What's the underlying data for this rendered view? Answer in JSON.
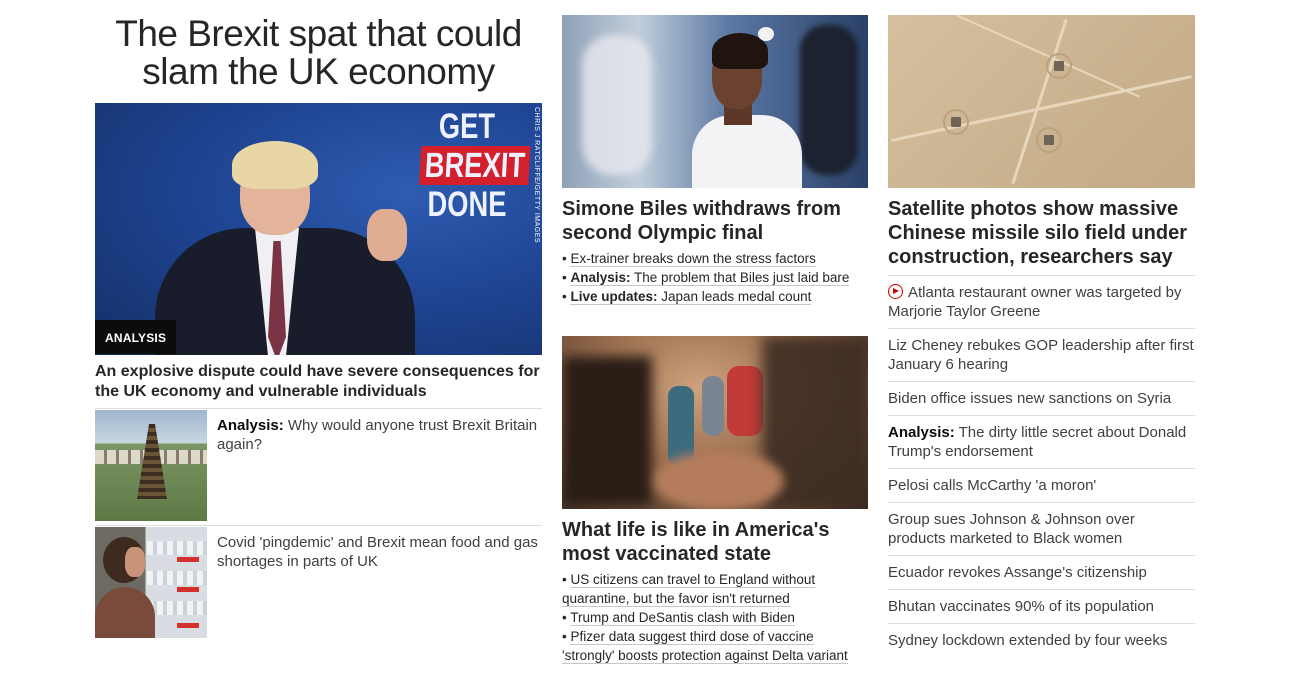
{
  "left": {
    "lead_headline": "The Brexit spat that could slam the UK economy",
    "hero": {
      "sign_line1": "GET",
      "sign_line2": "BREXIT",
      "sign_line3": "DONE",
      "credit": "CHRIS J RATCLIFFE/GETTY IMAGES",
      "badge": "ANALYSIS",
      "dek": "An explosive dispute could have severe consequences for the UK economy and vulnerable individuals"
    },
    "stories": [
      {
        "label": "Analysis:",
        "text": " Why would anyone trust Brexit Britain again?"
      },
      {
        "label": "",
        "text": "Covid 'pingdemic' and Brexit mean food and gas shortages in parts of UK"
      }
    ]
  },
  "middle": {
    "story1": {
      "headline": "Simone Biles withdraws from second Olympic final",
      "bullets": [
        {
          "label": "",
          "text": "Ex-trainer breaks down the stress factors"
        },
        {
          "label": "Analysis:",
          "text": " The problem that Biles just laid bare"
        },
        {
          "label": "Live updates:",
          "text": " Japan leads medal count"
        }
      ]
    },
    "story2": {
      "headline": "What life is like in America's most vaccinated state",
      "bullets": [
        "US citizens can travel to England without quarantine, but the favor isn't returned",
        "Trump and DeSantis clash with Biden",
        "Pfizer data suggest third dose of vaccine 'strongly' boosts protection against Delta variant"
      ]
    }
  },
  "right": {
    "headline": "Satellite photos show massive Chinese missile silo field under construction, researchers say",
    "list": [
      {
        "label": "",
        "text": "Atlanta restaurant owner was targeted by Marjorie Taylor Greene",
        "icon": "play-circle-icon"
      },
      {
        "label": "",
        "text": "Liz Cheney rebukes GOP leadership after first January 6 hearing"
      },
      {
        "label": "",
        "text": "Biden office issues new sanctions on Syria"
      },
      {
        "label": "Analysis:",
        "text": " The dirty little secret about Donald Trump's endorsement"
      },
      {
        "label": "",
        "text": "Pelosi calls McCarthy 'a moron'"
      },
      {
        "label": "",
        "text": "Group sues Johnson & Johnson over products marketed to Black women"
      },
      {
        "label": "",
        "text": "Ecuador revokes Assange's citizenship"
      },
      {
        "label": "",
        "text": "Bhutan vaccinates 90% of its population"
      },
      {
        "label": "",
        "text": "Sydney lockdown extended by four weeks"
      }
    ]
  },
  "colors": {
    "text": "#0c0c0c",
    "body_text": "#404040",
    "divider": "#dfdfdf",
    "badge_bg": "#0c0c0c",
    "video_red": "#cc0000"
  }
}
